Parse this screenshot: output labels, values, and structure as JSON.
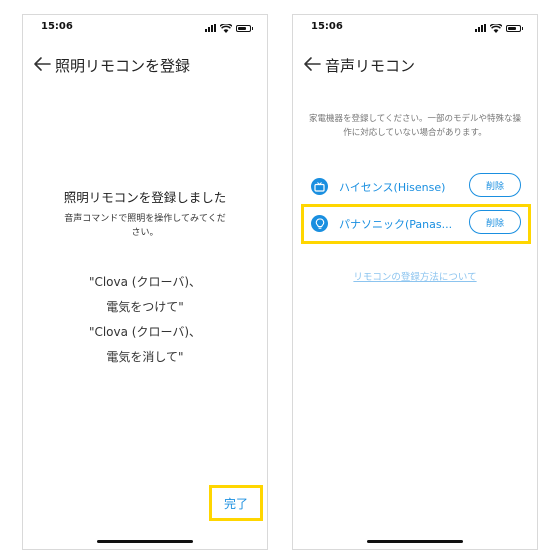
{
  "left": {
    "status_time": "15:06",
    "title": "照明リモコンを登録",
    "heading": "照明リモコンを登録しました",
    "subtext": "音声コマンドで照明を操作してみてください。",
    "commands": [
      "\"Clova (クローバ)、",
      "電気をつけて\"",
      "\"Clova (クローバ)、",
      "電気を消して\""
    ],
    "done_label": "完了"
  },
  "right": {
    "status_time": "15:06",
    "title": "音声リモコン",
    "info": "家電機器を登録してください。一部のモデルや特殊な操作に対応していない場合があります。",
    "devices": [
      {
        "name": "ハイセンス(Hisense)",
        "icon": "tv-icon",
        "delete_label": "削除"
      },
      {
        "name": "パナソニック(Panas...",
        "icon": "lightbulb-icon",
        "delete_label": "削除"
      }
    ],
    "link": "リモコンの登録方法について"
  },
  "colors": {
    "accent": "#1a8fe0",
    "highlight": "#ffd600"
  }
}
